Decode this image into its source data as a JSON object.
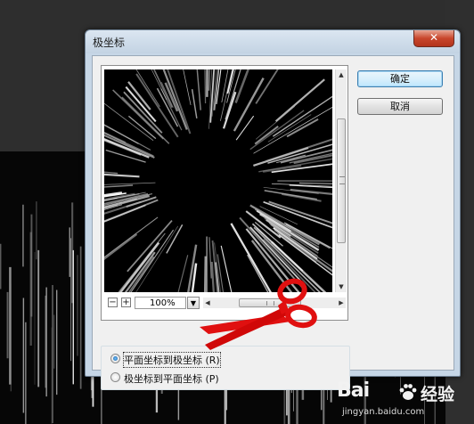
{
  "dialog": {
    "title": "极坐标",
    "close_glyph": "✕"
  },
  "buttons": {
    "ok_label": "确定",
    "cancel_label": "取消"
  },
  "preview": {
    "zoom_value": "100%",
    "zoom_minus": "−",
    "zoom_plus": "+"
  },
  "options": [
    {
      "label": "平面坐标到极坐标 (R)",
      "selected": true
    },
    {
      "label": "极坐标到平面坐标 (P)",
      "selected": false
    }
  ],
  "annotation": {
    "icon": "scissors-icon",
    "color": "#e01010"
  },
  "watermark": {
    "logo": "Bai",
    "logo_suffix": "经验",
    "url": "jingyan.baidu.com"
  },
  "colors": {
    "background_top": "#2e2e2e",
    "background_bottom": "#060606",
    "window_frame": "#c6d6e6",
    "close_button": "#c8462c",
    "default_button_border": "#3c7fb1"
  }
}
